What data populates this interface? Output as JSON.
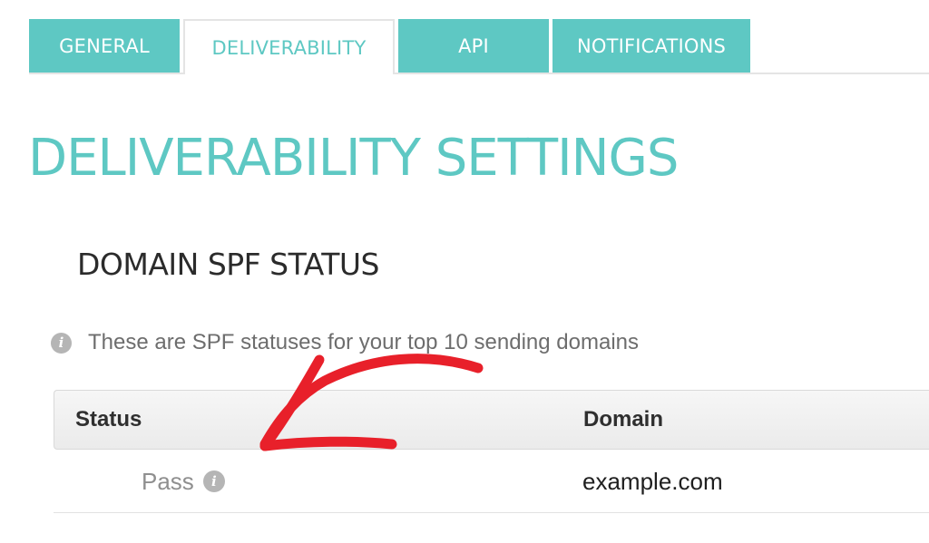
{
  "tabs": [
    {
      "label": "GENERAL",
      "active": false
    },
    {
      "label": "DELIVERABILITY",
      "active": true
    },
    {
      "label": "API",
      "active": false
    },
    {
      "label": "NOTIFICATIONS",
      "active": false
    }
  ],
  "page": {
    "title": "DELIVERABILITY SETTINGS"
  },
  "spf_section": {
    "title": "DOMAIN SPF STATUS",
    "info_text": "These are SPF statuses for your top 10 sending domains",
    "table": {
      "columns": [
        "Status",
        "Domain"
      ],
      "rows": [
        {
          "status": "Pass",
          "domain": "example.com"
        }
      ]
    }
  },
  "colors": {
    "accent": "#5ec8c3",
    "annotation": "#e8202a"
  },
  "icons": {
    "info": "info-icon",
    "annotation": "arrow-annotation"
  }
}
